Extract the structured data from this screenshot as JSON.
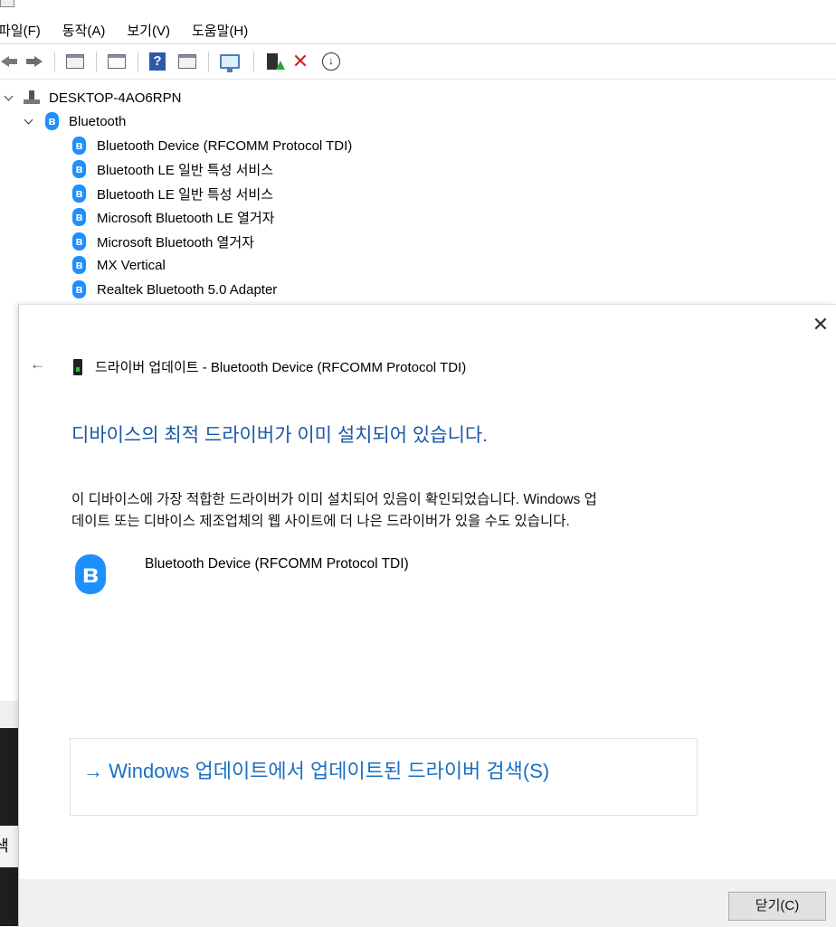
{
  "menubar": {
    "items": [
      "파일(F)",
      "동작(A)",
      "보기(V)",
      "도움말(H)"
    ]
  },
  "toolbar": {
    "icons": [
      "back-arrow-icon",
      "forward-arrow-icon",
      "console-tree-icon",
      "properties-icon",
      "help-icon",
      "view-icon",
      "scan-hardware-icon",
      "update-driver-icon",
      "uninstall-icon",
      "download-icon"
    ]
  },
  "tree": {
    "computer": "DESKTOP-4AO6RPN",
    "category": "Bluetooth",
    "devices": [
      "Bluetooth Device (RFCOMM Protocol TDI)",
      "Bluetooth LE 일반 특성 서비스",
      "Bluetooth LE 일반 특성 서비스",
      "Microsoft Bluetooth LE 열거자",
      "Microsoft Bluetooth 열거자",
      "MX Vertical",
      "Realtek Bluetooth 5.0 Adapter"
    ]
  },
  "left_partial_text": "색",
  "dialog": {
    "close_glyph": "✕",
    "back_glyph": "←",
    "header": "드라이버 업데이트 - Bluetooth Device (RFCOMM Protocol TDI)",
    "headline": "디바이스의 최적 드라이버가 이미 설치되어 있습니다.",
    "description_line1": "이 디바이스에 가장 적합한 드라이버가 이미 설치되어 있음이 확인되었습니다. Windows 업",
    "description_line2": "데이트 또는 디바이스 제조업체의 웹 사이트에 더 나은 드라이버가 있을 수도 있습니다.",
    "device_name": "Bluetooth Device (RFCOMM Protocol TDI)",
    "search_link": "→ Windows 업데이트에서 업데이트된 드라이버 검색(S)",
    "close_button": "닫기(C)"
  },
  "colors": {
    "headline": "#1a58a8",
    "link": "#1a6fc2",
    "bluetooth": "#1e8fff",
    "footer": "#f0f0f0"
  }
}
